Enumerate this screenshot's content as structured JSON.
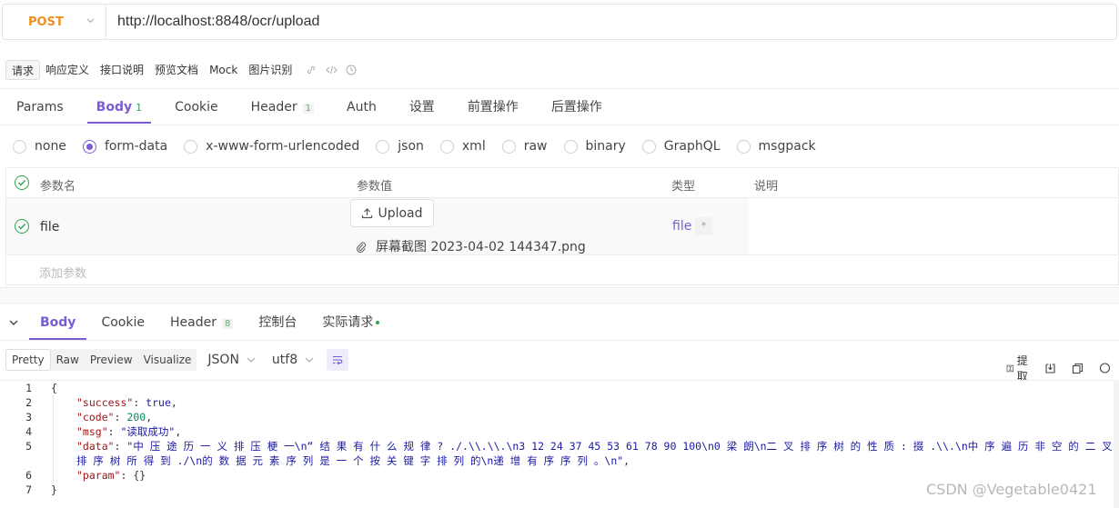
{
  "request": {
    "method": "POST",
    "url": "http://localhost:8848/ocr/upload"
  },
  "doc_tabs": [
    "请求",
    "响应定义",
    "接口说明",
    "预览文档",
    "Mock",
    "图片识别"
  ],
  "req_tabs": [
    {
      "label": "Params"
    },
    {
      "label": "Body",
      "count": "1"
    },
    {
      "label": "Cookie"
    },
    {
      "label": "Header",
      "count": "1"
    },
    {
      "label": "Auth"
    },
    {
      "label": "设置"
    },
    {
      "label": "前置操作"
    },
    {
      "label": "后置操作"
    }
  ],
  "body_types": [
    "none",
    "form-data",
    "x-www-form-urlencoded",
    "json",
    "xml",
    "raw",
    "binary",
    "GraphQL",
    "msgpack"
  ],
  "body_selected": "form-data",
  "params": {
    "headers": [
      "参数名",
      "参数值",
      "类型",
      "说明"
    ],
    "row": {
      "name": "file",
      "upload_label": "Upload",
      "file_name": "屏幕截图 2023-04-02 144347.png",
      "type": "file",
      "required": "*"
    },
    "add_placeholder": "添加参数"
  },
  "res_tabs": [
    {
      "label": "Body"
    },
    {
      "label": "Cookie"
    },
    {
      "label": "Header",
      "count": "8"
    },
    {
      "label": "控制台"
    },
    {
      "label": "实际请求"
    }
  ],
  "format": {
    "views": [
      "Pretty",
      "Raw",
      "Preview",
      "Visualize"
    ],
    "lang": "JSON",
    "encoding": "utf8"
  },
  "tools": {
    "extract": "提取"
  },
  "response": {
    "k_success": "\"success\"",
    "v_success": "true",
    "k_code": "\"code\"",
    "v_code": "200",
    "k_msg": "\"msg\"",
    "v_msg": "\"读取成功\"",
    "k_data": "\"data\"",
    "v_data_1": "\"中 压 途 历 一 义 排 压 梗 一\\n“ 结 果 有 什 么 规 律 ? ./.\\\\.\\\\.\\n3 12 24 37 45 53 61 78 90 100\\n0 梁 朗\\n二 叉 排 序 树 的 性 质 : 掇 .\\\\.\\n中 序 遍 历 非 空 的 二 叉",
    "v_data_2": "排 序 树 所 得 到 ./\\n的 数 据 元 素 序 列 是 一 个 按 关 键 字 排 列 的\\n递 增 有 序 序 列 。\\n\"",
    "k_param": "\"param\"",
    "v_param": "{}"
  },
  "watermark": "CSDN @Vegetable0421"
}
